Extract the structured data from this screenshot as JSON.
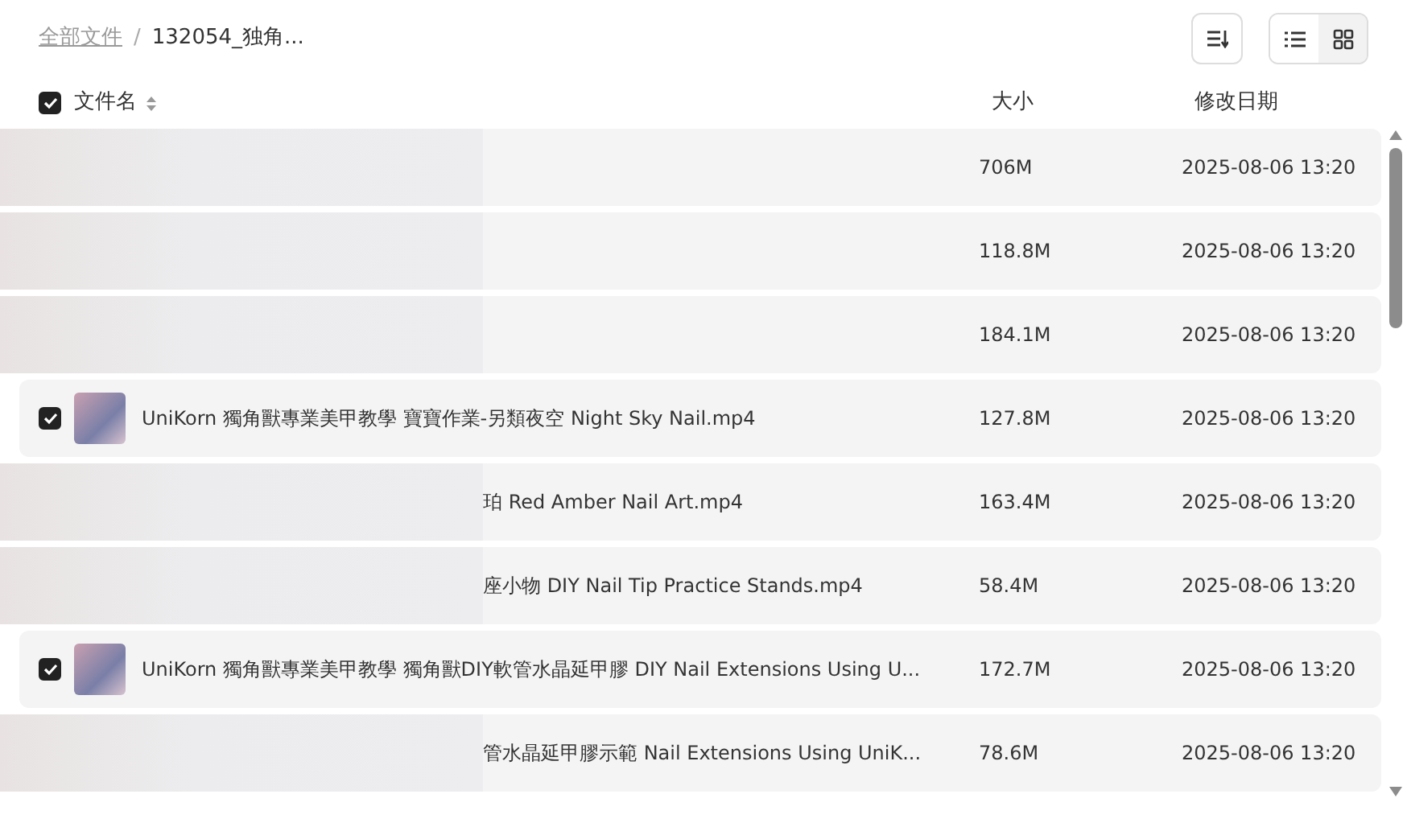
{
  "breadcrumb_separator": "/",
  "breadcrumb": [
    {
      "label": "全部文件",
      "current": false
    },
    {
      "label": "132054_独角...",
      "current": true
    }
  ],
  "view_toggle": [
    {
      "kind": "list",
      "selected": true
    },
    {
      "kind": "grid",
      "selected": false
    }
  ],
  "header": {
    "select_all_checked": true,
    "columns": [
      "文件名",
      "大小",
      "修改日期"
    ]
  },
  "rows": [
    {
      "redacted": true,
      "name": "",
      "size": "706M",
      "date": "2025-08-06 13:20"
    },
    {
      "redacted": true,
      "name": "",
      "size": "118.8M",
      "date": "2025-08-06 13:20"
    },
    {
      "redacted": true,
      "name": "",
      "size": "184.1M",
      "date": "2025-08-06 13:20"
    },
    {
      "redacted": false,
      "checked": true,
      "name": "UniKorn 獨角獸專業美甲教學 寶寶作業-另類夜空 Night Sky Nail.mp4",
      "size": "127.8M",
      "date": "2025-08-06 13:20"
    },
    {
      "redacted": true,
      "name": "珀 Red Amber Nail Art.mp4",
      "size": "163.4M",
      "date": "2025-08-06 13:20"
    },
    {
      "redacted": true,
      "name": "座小物 DIY Nail Tip Practice Stands.mp4",
      "size": "58.4M",
      "date": "2025-08-06 13:20"
    },
    {
      "redacted": false,
      "checked": true,
      "name": "UniKorn 獨角獸專業美甲教學 獨角獸DIY軟管水晶延甲膠 DIY Nail Extensions Using U...",
      "size": "172.7M",
      "date": "2025-08-06 13:20"
    },
    {
      "redacted": true,
      "name": "管水晶延甲膠示範 Nail Extensions Using UniK...",
      "size": "78.6M",
      "date": "2025-08-06 13:20"
    }
  ]
}
